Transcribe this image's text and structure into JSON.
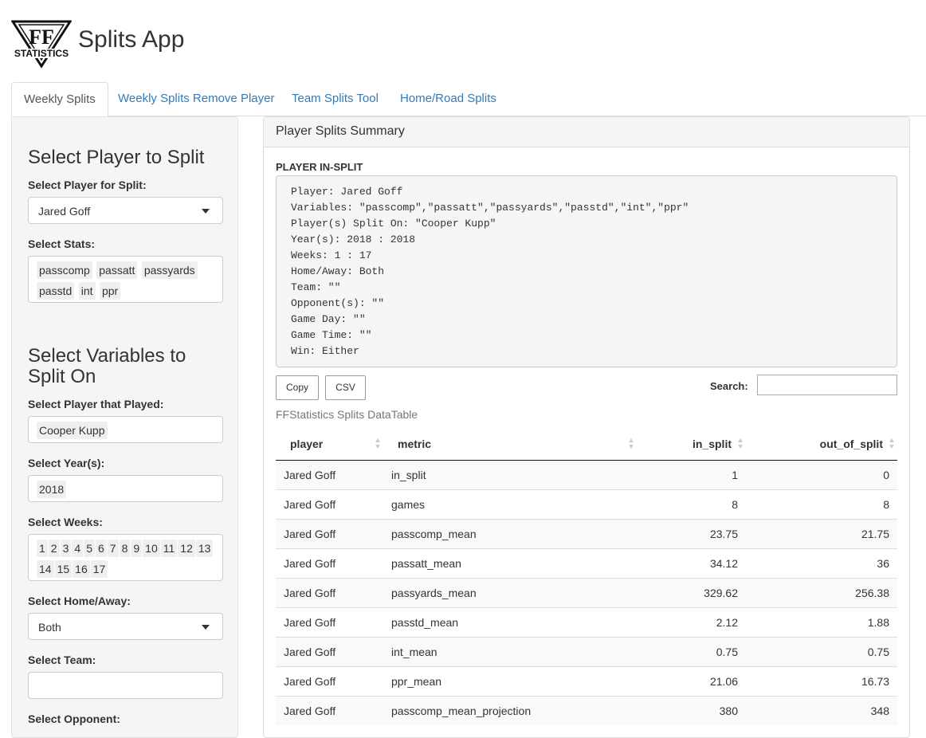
{
  "app": {
    "title": "Splits App",
    "logo_text": "STATISTICS",
    "logo_icon": "ff-statistics-logo"
  },
  "tabs": [
    {
      "label": "Weekly Splits",
      "active": true
    },
    {
      "label": "Weekly Splits Remove Player",
      "active": false
    },
    {
      "label": "Team Splits Tool",
      "active": false
    },
    {
      "label": "Home/Road Splits",
      "active": false
    }
  ],
  "sidebar": {
    "heading1": "Select Player to Split",
    "player_label": "Select Player for Split:",
    "player_value": "Jared Goff",
    "stats_label": "Select Stats:",
    "stats": [
      "passcomp",
      "passatt",
      "passyards",
      "passtd",
      "int",
      "ppr"
    ],
    "heading2": "Select Variables to Split On",
    "played_label": "Select Player that Played:",
    "played": [
      "Cooper Kupp"
    ],
    "years_label": "Select Year(s):",
    "years": [
      "2018"
    ],
    "weeks_label": "Select Weeks:",
    "weeks": [
      "1",
      "2",
      "3",
      "4",
      "5",
      "6",
      "7",
      "8",
      "9",
      "10",
      "11",
      "12",
      "13",
      "14",
      "15",
      "16",
      "17"
    ],
    "homeaway_label": "Select Home/Away:",
    "homeaway_value": "Both",
    "team_label": "Select Team:",
    "team_value": "",
    "opponent_label": "Select Opponent:"
  },
  "panel": {
    "title": "Player Splits Summary",
    "insplit_label": "PLAYER IN-SPLIT",
    "summary_lines": [
      "Player: Jared Goff",
      "Variables: \"passcomp\",\"passatt\",\"passyards\",\"passtd\",\"int\",\"ppr\"",
      "Player(s) Split On: \"Cooper Kupp\"",
      "Year(s): 2018 : 2018",
      "Weeks: 1 : 17",
      "Home/Away: Both",
      "Team: \"\"",
      "Opponent(s): \"\"",
      "Game Day: \"\"",
      "Game Time: \"\"",
      "Win: Either"
    ],
    "copy_label": "Copy",
    "csv_label": "CSV",
    "search_label": "Search:",
    "search_value": "",
    "caption": "FFStatistics Splits DataTable"
  },
  "table": {
    "columns": [
      "player",
      "metric",
      "in_split",
      "out_of_split"
    ],
    "rows": [
      [
        "Jared Goff",
        "in_split",
        "1",
        "0"
      ],
      [
        "Jared Goff",
        "games",
        "8",
        "8"
      ],
      [
        "Jared Goff",
        "passcomp_mean",
        "23.75",
        "21.75"
      ],
      [
        "Jared Goff",
        "passatt_mean",
        "34.12",
        "36"
      ],
      [
        "Jared Goff",
        "passyards_mean",
        "329.62",
        "256.38"
      ],
      [
        "Jared Goff",
        "passtd_mean",
        "2.12",
        "1.88"
      ],
      [
        "Jared Goff",
        "int_mean",
        "0.75",
        "0.75"
      ],
      [
        "Jared Goff",
        "ppr_mean",
        "21.06",
        "16.73"
      ],
      [
        "Jared Goff",
        "passcomp_mean_projection",
        "380",
        "348"
      ]
    ]
  }
}
